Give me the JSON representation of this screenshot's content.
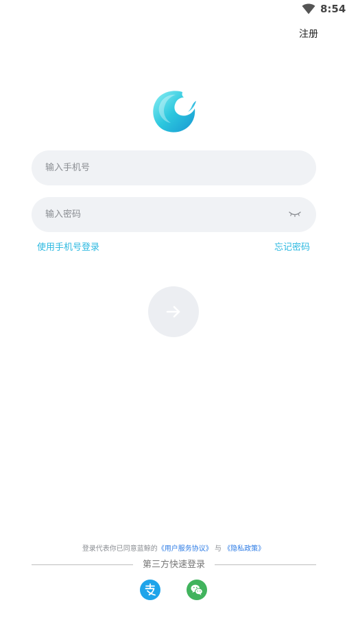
{
  "status_bar": {
    "time": "8:54",
    "wifi_icon": "wifi-icon"
  },
  "header": {
    "register_label": "注册"
  },
  "logo": {
    "icon": "wave-logo-icon",
    "colors": [
      "#7be6ef",
      "#25c2dc",
      "#1b9ed6"
    ]
  },
  "form": {
    "phone": {
      "placeholder": "输入手机号",
      "value": ""
    },
    "password": {
      "placeholder": "输入密码",
      "value": "",
      "toggle_icon": "eye-closed-icon"
    },
    "phone_login_link": "使用手机号登录",
    "forgot_password_link": "忘记密码",
    "submit_icon": "arrow-right-icon"
  },
  "agreement": {
    "prefix": "登录代表你已同意蓝鲸的",
    "user_agreement": "《用户服务协议》",
    "conjunction": "与",
    "privacy_policy": "《隐私政策》"
  },
  "third_party": {
    "label": "第三方快速登录",
    "alipay_icon": "alipay-icon",
    "wechat_icon": "wechat-icon"
  },
  "colors": {
    "accent": "#2bb8e0",
    "link": "#2c7be5",
    "input_bg": "#f0f2f5",
    "alipay": "#1fa4ea",
    "wechat": "#41b35d"
  }
}
